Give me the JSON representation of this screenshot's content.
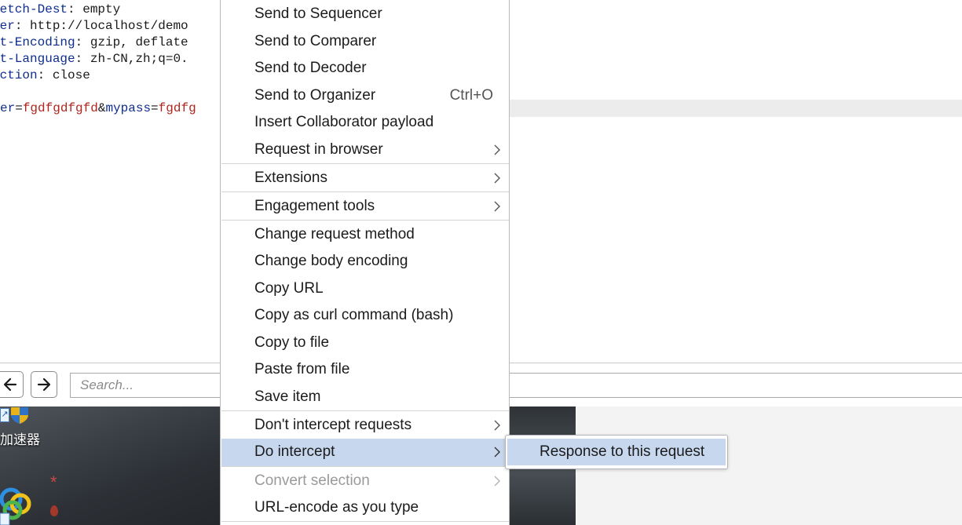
{
  "editor": {
    "headers": [
      {
        "key": "Fetch-Dest",
        "value": " empty"
      },
      {
        "key": "cer",
        "value": " http://localhost/demo"
      },
      {
        "key": "ot-Encoding",
        "value": " gzip, deflate"
      },
      {
        "key": "ot-Language",
        "value": " zh-CN,zh;q=0."
      },
      {
        "key": "ection",
        "value": " close"
      }
    ],
    "body": {
      "p1_key": "er",
      "p1_val": "fgdfgdfgfd",
      "amp": "&",
      "p2_key": "mypass",
      "p2_val": "fgdfg"
    },
    "colors": {
      "key": "#0f2d8f",
      "param_value": "#b0251d",
      "line_highlight": "#ececec"
    }
  },
  "toolbar": {
    "back_icon": "arrow-left-icon",
    "forward_icon": "arrow-right-icon",
    "search_placeholder": "Search..."
  },
  "desktop": {
    "taskbar_text": "加速器"
  },
  "context_menu": {
    "items": [
      {
        "label": "Send to Sequencer"
      },
      {
        "label": "Send to Comparer"
      },
      {
        "label": "Send to Decoder"
      },
      {
        "label": "Send to Organizer",
        "shortcut": "Ctrl+O"
      },
      {
        "label": "Insert Collaborator payload"
      },
      {
        "label": "Request in browser",
        "submenu": true
      },
      {
        "label": "Extensions",
        "submenu": true
      },
      {
        "label": "Engagement tools",
        "submenu": true
      },
      {
        "label": "Change request method"
      },
      {
        "label": "Change body encoding"
      },
      {
        "label": "Copy URL"
      },
      {
        "label": "Copy as curl command (bash)"
      },
      {
        "label": "Copy to file"
      },
      {
        "label": "Paste from file"
      },
      {
        "label": "Save item"
      },
      {
        "label": "Don't intercept requests",
        "submenu": true
      },
      {
        "label": "Do intercept",
        "submenu": true,
        "active": true
      },
      {
        "label": "Convert selection",
        "submenu": true,
        "disabled": true
      },
      {
        "label": "URL-encode as you type"
      }
    ],
    "highlight_color": "#c7d7ee"
  },
  "submenu": {
    "items": [
      {
        "label": "Response to this request",
        "active": true
      }
    ]
  }
}
